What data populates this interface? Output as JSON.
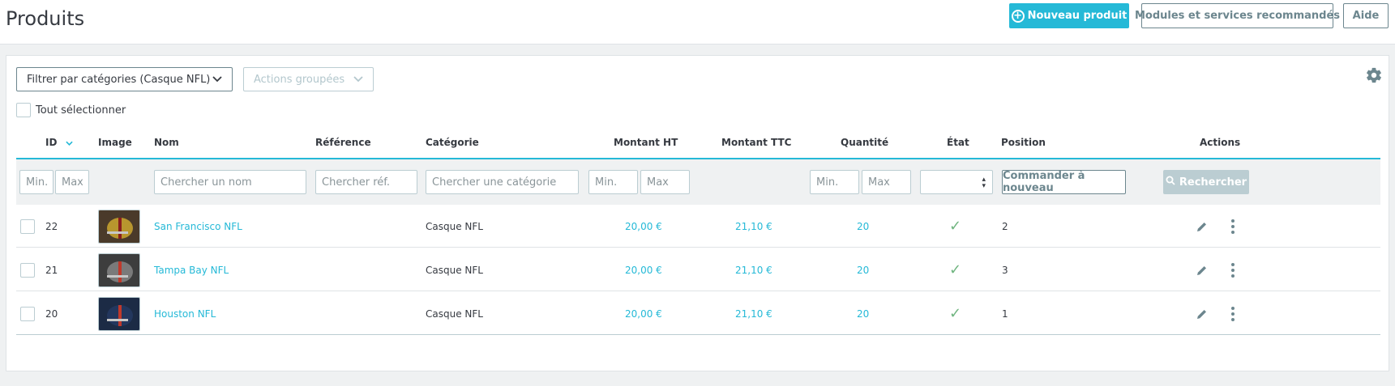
{
  "header": {
    "title": "Produits",
    "buttons": {
      "new_product": "Nouveau produit",
      "modules": "Modules et services recommandés",
      "help": "Aide"
    }
  },
  "toolbar": {
    "category_filter": "Filtrer par catégories (Casque NFL)",
    "bulk_actions": "Actions groupées",
    "select_all": "Tout sélectionner"
  },
  "columns": {
    "id": "ID",
    "image": "Image",
    "name": "Nom",
    "reference": "Référence",
    "category": "Catégorie",
    "price_ht": "Montant HT",
    "price_ttc": "Montant TTC",
    "quantity": "Quantité",
    "status": "État",
    "position": "Position",
    "actions": "Actions"
  },
  "filters": {
    "id_min": "Min.",
    "id_max": "Max",
    "name": "Chercher un nom",
    "reference": "Chercher réf.",
    "category": "Chercher une catégorie",
    "price_min": "Min.",
    "price_max": "Max",
    "qty_min": "Min.",
    "qty_max": "Max",
    "reorder": "Commander à nouveau",
    "search": "Rechercher"
  },
  "rows": [
    {
      "id": "22",
      "name": "San Francisco NFL",
      "category": "Casque NFL",
      "price_ht": "20,00 €",
      "price_ttc": "21,10 €",
      "quantity": "20",
      "active": true,
      "position": "2",
      "image_colors": [
        "#4a3a2a",
        "#b8962e",
        "#8a1e1e"
      ]
    },
    {
      "id": "21",
      "name": "Tampa Bay NFL",
      "category": "Casque NFL",
      "price_ht": "20,00 €",
      "price_ttc": "21,10 €",
      "quantity": "20",
      "active": true,
      "position": "3",
      "image_colors": [
        "#3d3d3d",
        "#7a7a7a",
        "#c0392b"
      ]
    },
    {
      "id": "20",
      "name": "Houston NFL",
      "category": "Casque NFL",
      "price_ht": "20,00 €",
      "price_ttc": "21,10 €",
      "quantity": "20",
      "active": true,
      "position": "1",
      "image_colors": [
        "#1c2b45",
        "#23375e",
        "#c0392b"
      ]
    }
  ],
  "icons": {
    "sort": "sort-down-icon",
    "settings": "gear-icon",
    "edit": "pencil-icon",
    "more": "kebab-icon",
    "status": "check-icon",
    "search": "search-icon"
  },
  "colors": {
    "primary": "#25b9d7",
    "success": "#70b580",
    "muted": "#6c868e",
    "border": "#bbcdd2"
  }
}
